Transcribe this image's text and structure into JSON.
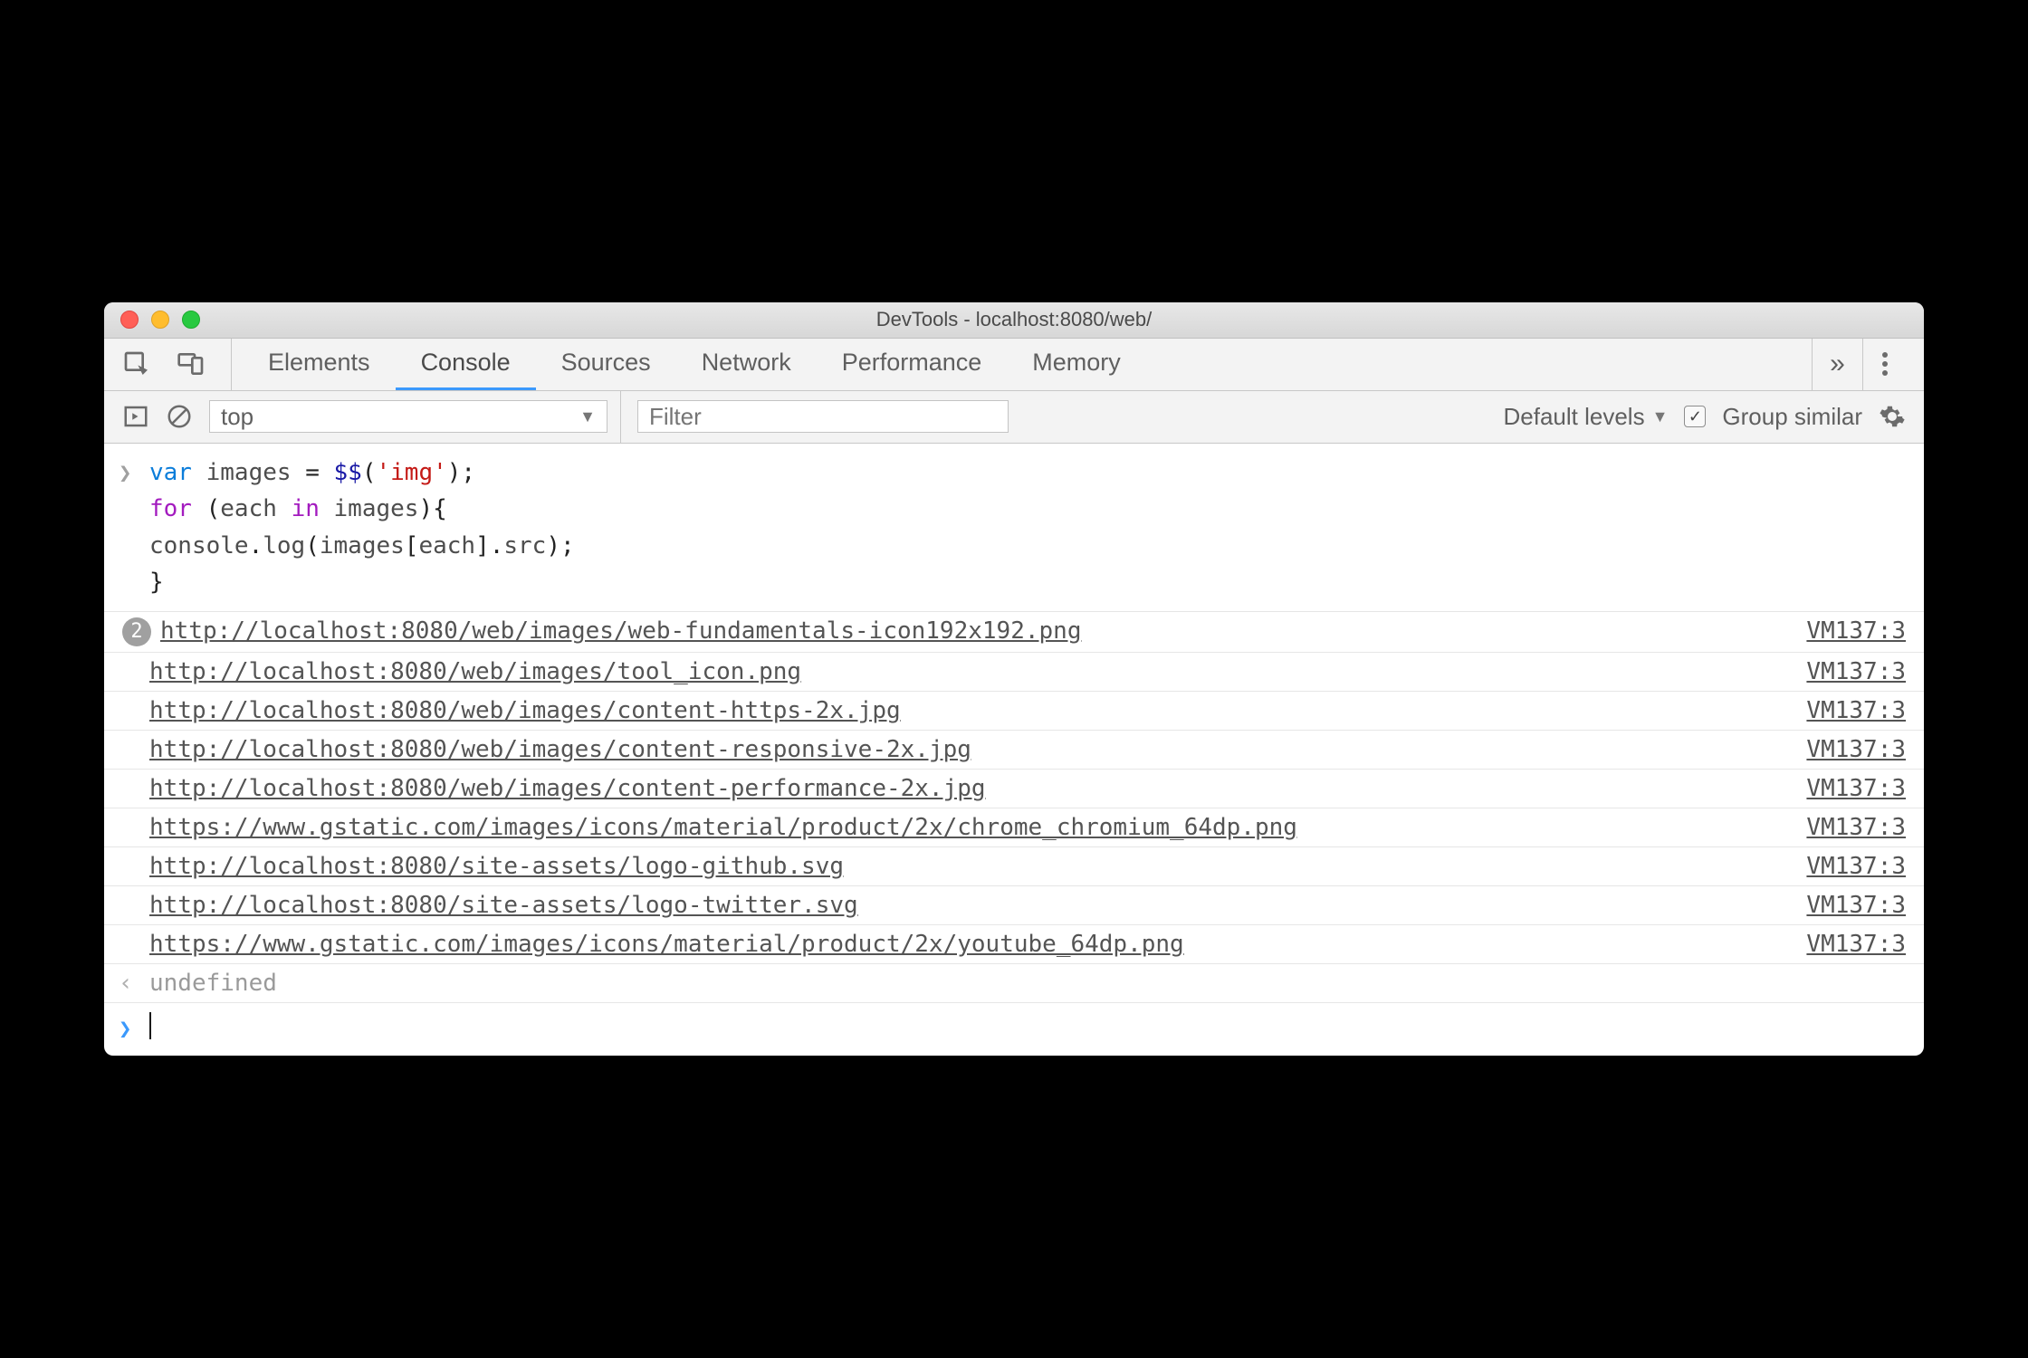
{
  "window": {
    "title": "DevTools - localhost:8080/web/"
  },
  "tabs": {
    "items": [
      "Elements",
      "Console",
      "Sources",
      "Network",
      "Performance",
      "Memory"
    ],
    "active": "Console",
    "more": "»"
  },
  "filterbar": {
    "context": "top",
    "filterPlaceholder": "Filter",
    "levelsLabel": "Default levels",
    "groupSimilarLabel": "Group similar",
    "groupSimilarChecked": true
  },
  "code": {
    "lines": [
      {
        "tokens": [
          {
            "t": "var ",
            "c": "kw"
          },
          {
            "t": "images ",
            "c": "prop"
          },
          {
            "t": "= ",
            "c": "paren"
          },
          {
            "t": "$$",
            "c": "name"
          },
          {
            "t": "(",
            "c": "paren"
          },
          {
            "t": "'img'",
            "c": "str"
          },
          {
            "t": ");",
            "c": "paren"
          }
        ]
      },
      {
        "tokens": [
          {
            "t": "for ",
            "c": "kw2"
          },
          {
            "t": "(",
            "c": "paren"
          },
          {
            "t": "each ",
            "c": "prop"
          },
          {
            "t": "in ",
            "c": "kw2"
          },
          {
            "t": "images",
            "c": "prop"
          },
          {
            "t": "){",
            "c": "paren"
          }
        ]
      },
      {
        "tokens": [
          {
            "t": "    console",
            "c": "prop"
          },
          {
            "t": ".",
            "c": "paren"
          },
          {
            "t": "log",
            "c": "prop"
          },
          {
            "t": "(",
            "c": "paren"
          },
          {
            "t": "images",
            "c": "prop"
          },
          {
            "t": "[",
            "c": "paren"
          },
          {
            "t": "each",
            "c": "prop"
          },
          {
            "t": "].",
            "c": "paren"
          },
          {
            "t": "src",
            "c": "prop"
          },
          {
            "t": ");",
            "c": "paren"
          }
        ]
      },
      {
        "tokens": [
          {
            "t": "}",
            "c": "paren"
          }
        ]
      }
    ]
  },
  "logs": [
    {
      "count": 2,
      "url": "http://localhost:8080/web/images/web-fundamentals-icon192x192.png",
      "source": "VM137:3"
    },
    {
      "url": "http://localhost:8080/web/images/tool_icon.png",
      "source": "VM137:3"
    },
    {
      "url": "http://localhost:8080/web/images/content-https-2x.jpg",
      "source": "VM137:3"
    },
    {
      "url": "http://localhost:8080/web/images/content-responsive-2x.jpg",
      "source": "VM137:3"
    },
    {
      "url": "http://localhost:8080/web/images/content-performance-2x.jpg",
      "source": "VM137:3"
    },
    {
      "url": "https://www.gstatic.com/images/icons/material/product/2x/chrome_chromium_64dp.png",
      "source": "VM137:3"
    },
    {
      "url": "http://localhost:8080/site-assets/logo-github.svg",
      "source": "VM137:3"
    },
    {
      "url": "http://localhost:8080/site-assets/logo-twitter.svg",
      "source": "VM137:3"
    },
    {
      "url": "https://www.gstatic.com/images/icons/material/product/2x/youtube_64dp.png",
      "source": "VM137:3"
    }
  ],
  "returnValue": "undefined"
}
